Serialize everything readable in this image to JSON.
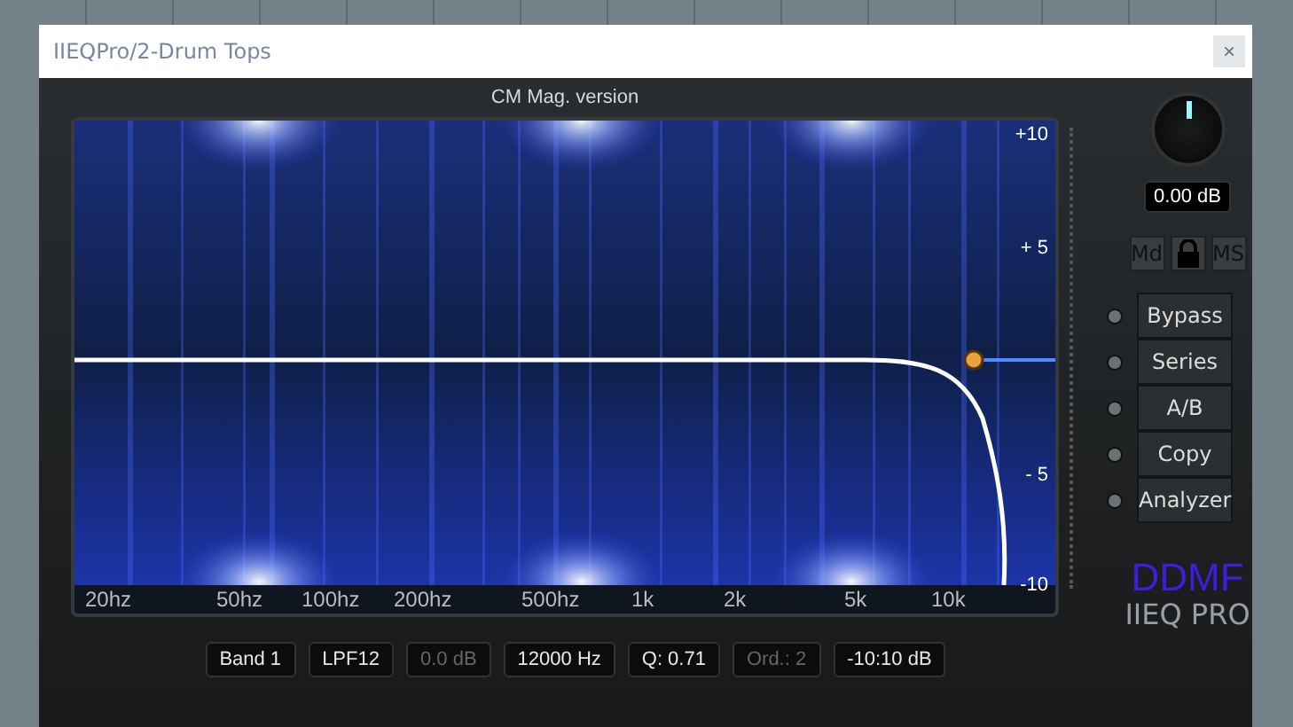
{
  "window": {
    "title": "IIEQPro/2-Drum Tops",
    "close": "×"
  },
  "header": "CM Mag. version",
  "graph": {
    "freq_labels": [
      "20hz",
      "50hz",
      "100hz",
      "200hz",
      "500hz",
      "1k",
      "2k",
      "5k",
      "10k"
    ],
    "db_labels": [
      "+10",
      "+ 5",
      "- 5",
      "-10"
    ]
  },
  "output": {
    "level": 0.5,
    "value": "0.00 dB"
  },
  "mode_buttons": [
    {
      "kind": "text",
      "label": "Md"
    },
    {
      "kind": "lock"
    },
    {
      "kind": "text",
      "label": "MS"
    }
  ],
  "actions": [
    {
      "label": "Bypass",
      "on": false
    },
    {
      "label": "Series",
      "on": false
    },
    {
      "label": "A/B",
      "on": false
    },
    {
      "label": "Copy",
      "on": false
    },
    {
      "label": "Analyzer",
      "on": false
    }
  ],
  "band": [
    {
      "text": "Band 1",
      "disabled": false
    },
    {
      "text": "LPF12",
      "disabled": false
    },
    {
      "text": "0.0 dB",
      "disabled": true
    },
    {
      "text": "12000 Hz",
      "disabled": false
    },
    {
      "text": "Q: 0.71",
      "disabled": false
    },
    {
      "text": "Ord.: 2",
      "disabled": true
    },
    {
      "text": "-10:10 dB",
      "disabled": false
    }
  ],
  "brand": {
    "name": "DDMF",
    "product": "IIEQ PRO"
  }
}
